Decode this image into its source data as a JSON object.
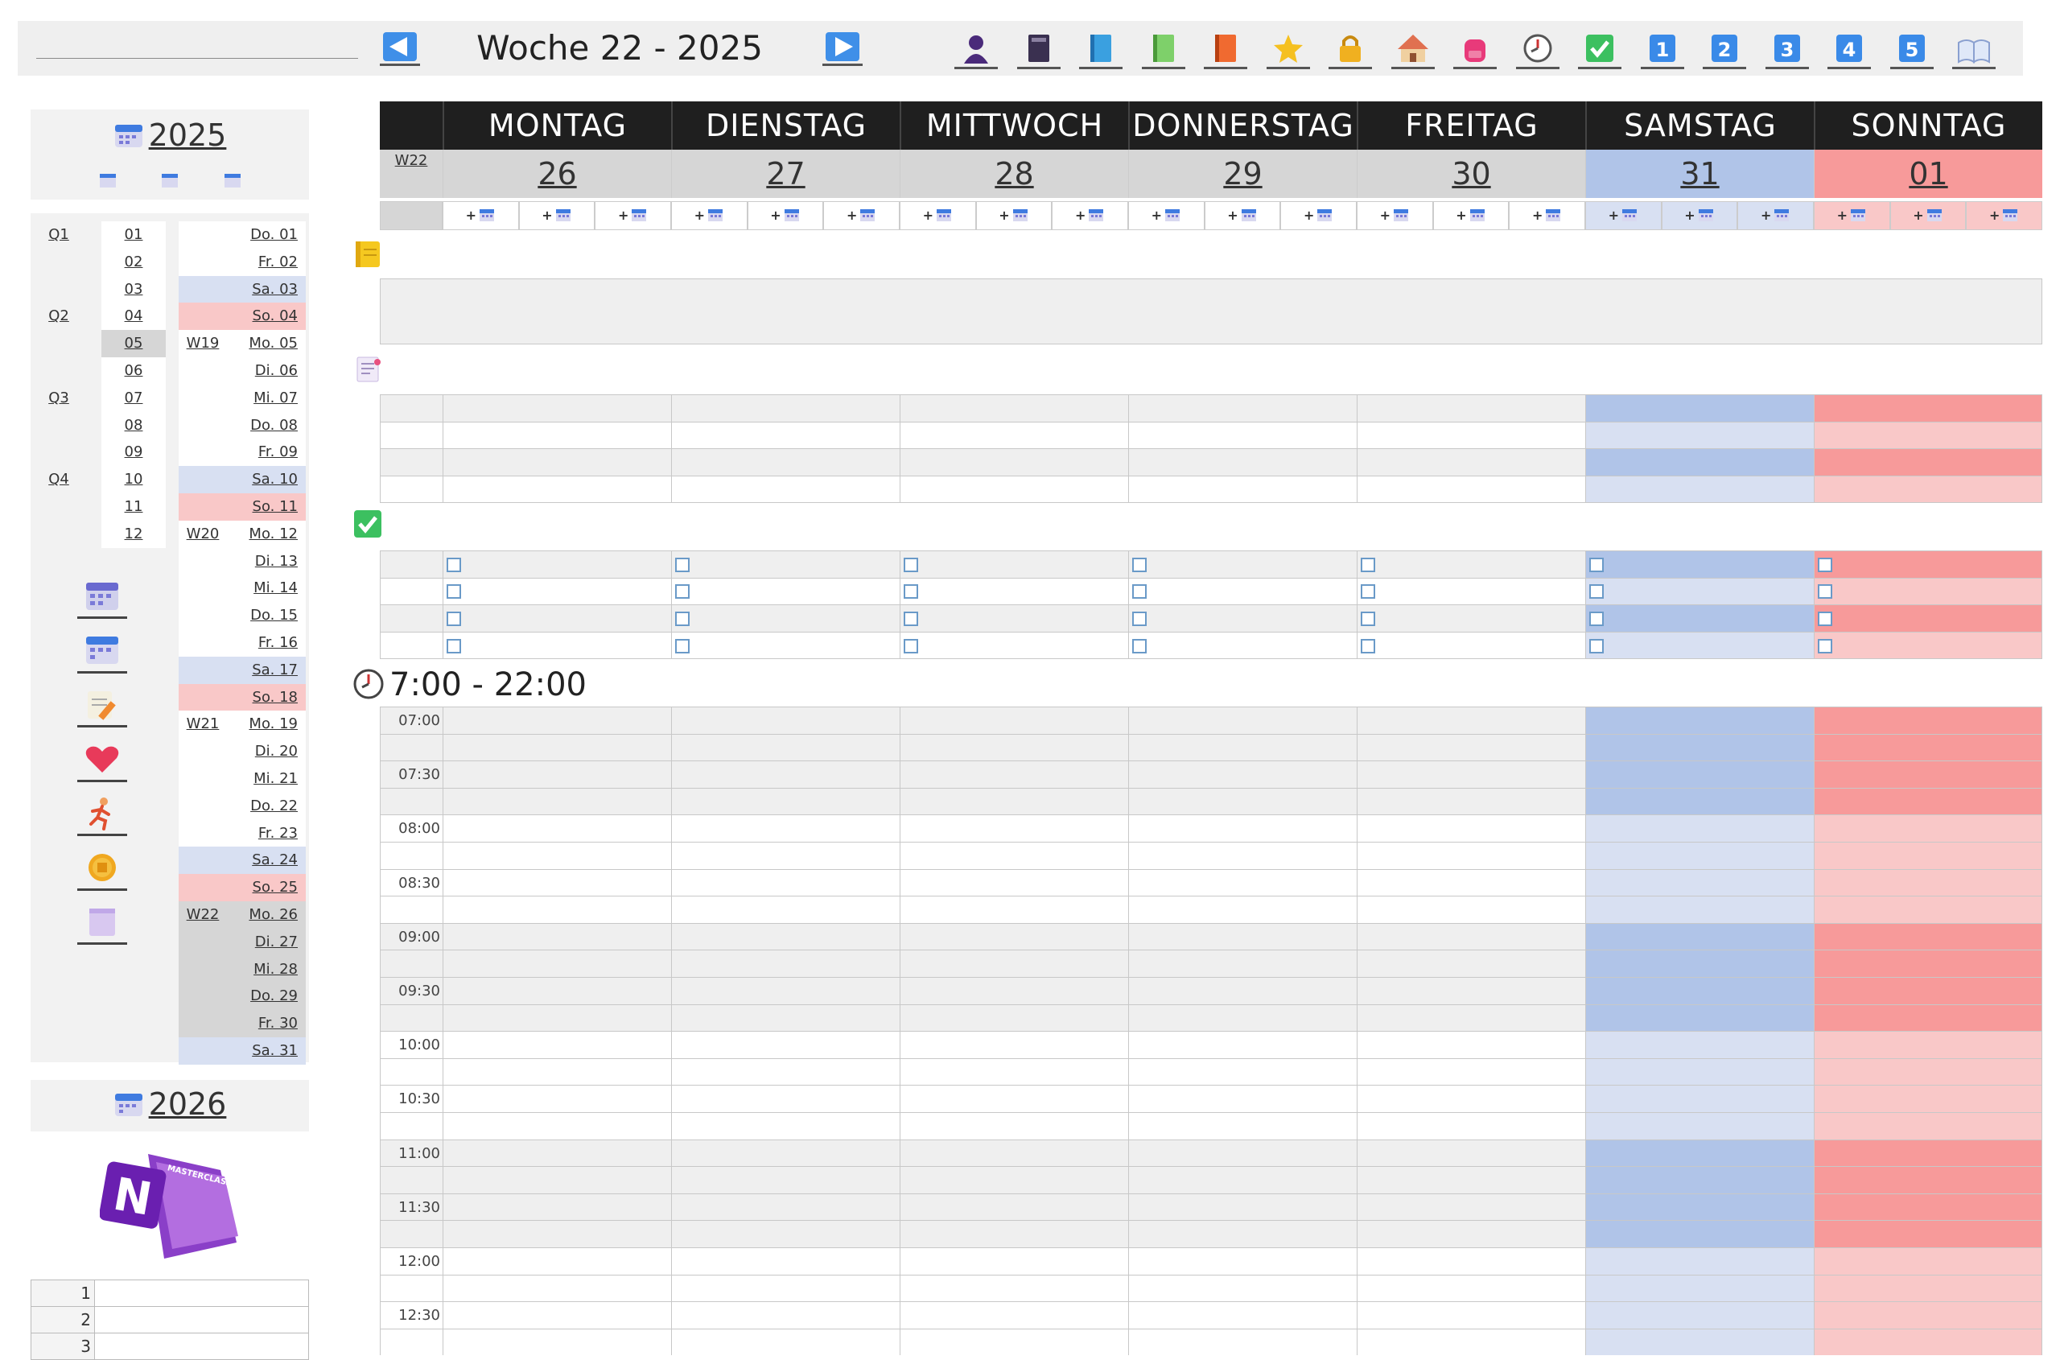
{
  "toolbar": {
    "week_title": "Woche 22 - 2025",
    "prev_icon": "triangle-left-icon",
    "next_icon": "triangle-right-icon",
    "icons": [
      "person-icon",
      "notebook-dark-icon",
      "notebook-blue-icon",
      "notebook-green-icon",
      "notebook-orange-icon",
      "star-icon",
      "lock-icon",
      "house-icon",
      "backpack-icon",
      "clock-icon",
      "checkmark-icon",
      "number-1-icon",
      "number-2-icon",
      "number-3-icon",
      "number-4-icon",
      "number-5-icon",
      "open-book-icon"
    ],
    "number_labels": [
      "1",
      "2",
      "3",
      "4",
      "5"
    ]
  },
  "sidebar": {
    "year_current": "2025",
    "year_next": "2026",
    "quarters": [
      "Q1",
      "Q2",
      "Q3",
      "Q4"
    ],
    "months": [
      "01",
      "02",
      "03",
      "04",
      "05",
      "06",
      "07",
      "08",
      "09",
      "10",
      "11",
      "12"
    ],
    "weeks": [
      {
        "label": "W19",
        "row": 4
      },
      {
        "label": "W20",
        "row": 11
      },
      {
        "label": "W21",
        "row": 18
      },
      {
        "label": "W22",
        "row": 25
      }
    ],
    "days": [
      {
        "label": "Do. 01",
        "type": "weekday"
      },
      {
        "label": "Fr. 02",
        "type": "weekday"
      },
      {
        "label": "Sa. 03",
        "type": "sat"
      },
      {
        "label": "So. 04",
        "type": "sun"
      },
      {
        "label": "Mo. 05",
        "type": "weekday"
      },
      {
        "label": "Di. 06",
        "type": "weekday"
      },
      {
        "label": "Mi. 07",
        "type": "weekday"
      },
      {
        "label": "Do. 08",
        "type": "weekday"
      },
      {
        "label": "Fr. 09",
        "type": "weekday"
      },
      {
        "label": "Sa. 10",
        "type": "sat"
      },
      {
        "label": "So. 11",
        "type": "sun"
      },
      {
        "label": "Mo. 12",
        "type": "weekday"
      },
      {
        "label": "Di. 13",
        "type": "weekday"
      },
      {
        "label": "Mi. 14",
        "type": "weekday"
      },
      {
        "label": "Do. 15",
        "type": "weekday"
      },
      {
        "label": "Fr. 16",
        "type": "weekday"
      },
      {
        "label": "Sa. 17",
        "type": "sat"
      },
      {
        "label": "So. 18",
        "type": "sun"
      },
      {
        "label": "Mo. 19",
        "type": "weekday"
      },
      {
        "label": "Di. 20",
        "type": "weekday"
      },
      {
        "label": "Mi. 21",
        "type": "weekday"
      },
      {
        "label": "Do. 22",
        "type": "weekday"
      },
      {
        "label": "Fr. 23",
        "type": "weekday"
      },
      {
        "label": "Sa. 24",
        "type": "sat"
      },
      {
        "label": "So. 25",
        "type": "sun"
      },
      {
        "label": "Mo. 26",
        "type": "current"
      },
      {
        "label": "Di. 27",
        "type": "current"
      },
      {
        "label": "Mi. 28",
        "type": "current"
      },
      {
        "label": "Do. 29",
        "type": "current"
      },
      {
        "label": "Fr. 30",
        "type": "current"
      },
      {
        "label": "Sa. 31",
        "type": "sat"
      }
    ],
    "side_icons": [
      "calendar-icon",
      "calendar-blue-icon",
      "notepad-pencil-icon",
      "heart-icon",
      "runner-icon",
      "coin-icon",
      "purple-square-icon"
    ],
    "logo_text": "MASTERCLASS",
    "bottom_rows": [
      "1",
      "2",
      "3"
    ]
  },
  "week": {
    "week_label": "W22",
    "days": [
      {
        "name": "MONTAG",
        "num": "26",
        "type": "weekday"
      },
      {
        "name": "DIENSTAG",
        "num": "27",
        "type": "weekday"
      },
      {
        "name": "MITTWOCH",
        "num": "28",
        "type": "weekday"
      },
      {
        "name": "DONNERSTAG",
        "num": "29",
        "type": "weekday"
      },
      {
        "name": "FREITAG",
        "num": "30",
        "type": "weekday"
      },
      {
        "name": "SAMSTAG",
        "num": "31",
        "type": "sat"
      },
      {
        "name": "SONNTAG",
        "num": "01",
        "type": "sun"
      }
    ],
    "add_label": "+",
    "section_icons": [
      "sticky-note-icon",
      "notes-list-icon",
      "checkbox-section-icon",
      "clock-section-icon"
    ],
    "time_range": "7:00 - 22:00",
    "times": [
      "07:00",
      "",
      "07:30",
      "",
      "08:00",
      "",
      "08:30",
      "",
      "09:00",
      "",
      "09:30",
      "",
      "10:00",
      "",
      "10:30",
      "",
      "11:00",
      "",
      "11:30",
      "",
      "12:00",
      "",
      "12:30",
      ""
    ]
  },
  "colors": {
    "header_bg": "#1f1f1f",
    "sat_dark": "#b0c4e8",
    "sat_light": "#d8e0f2",
    "sun_dark": "#f79a9a",
    "sun_light": "#f9c8c8",
    "weekday_grey": "#efefef",
    "daynum_grey": "#d6d6d6"
  }
}
